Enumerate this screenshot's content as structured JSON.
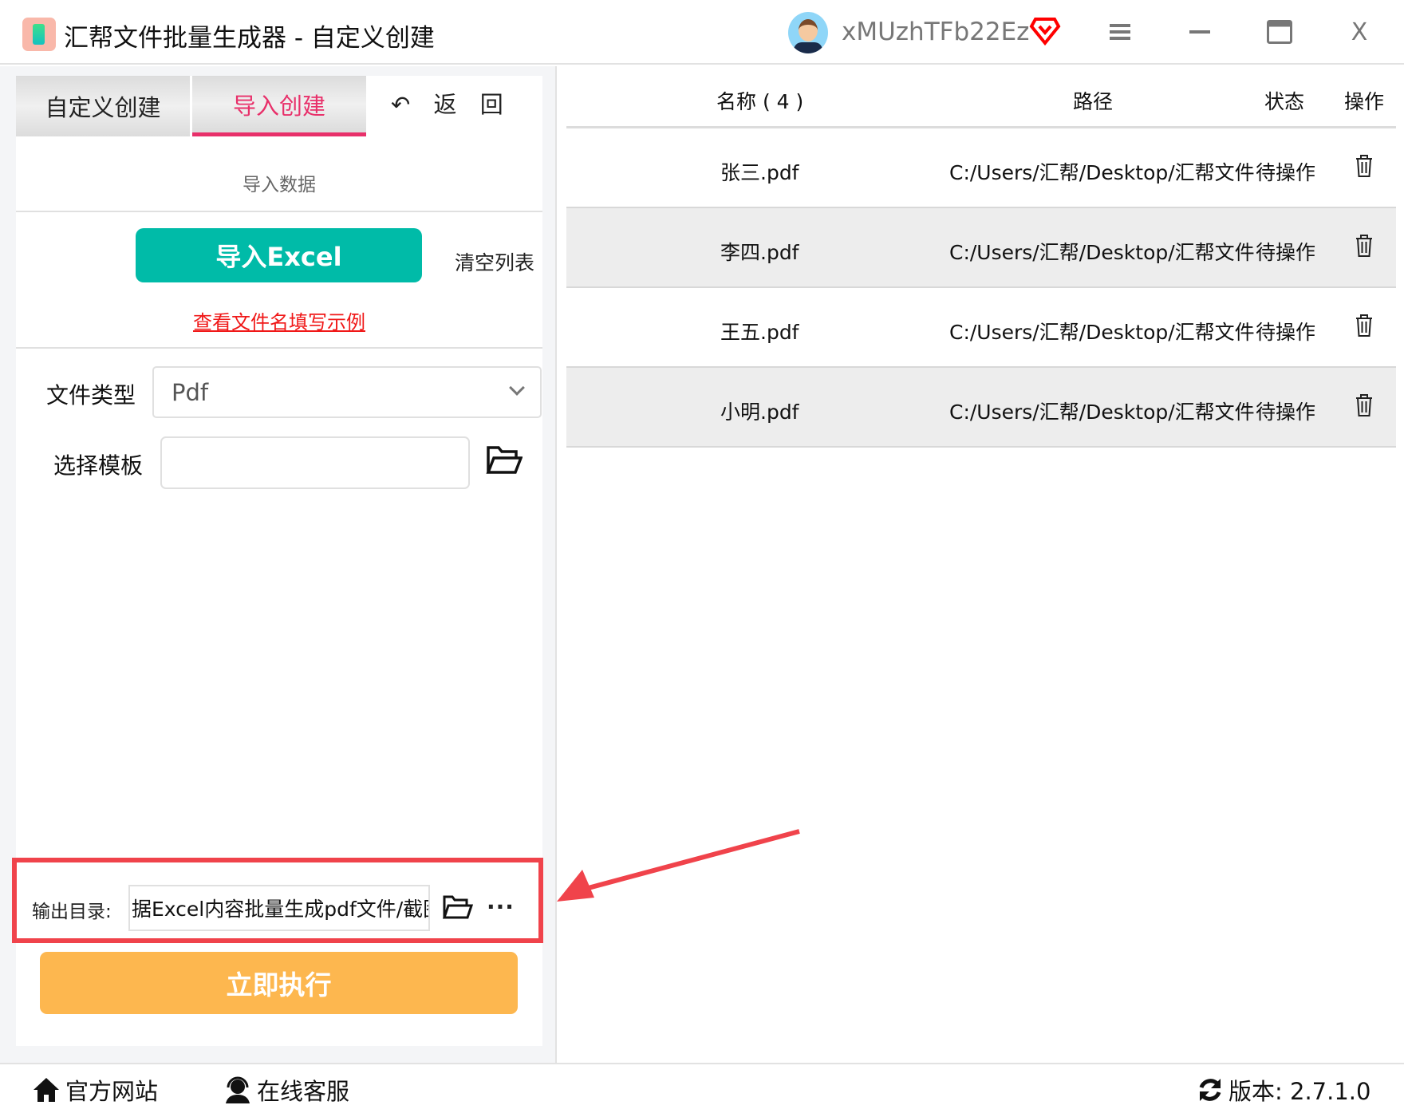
{
  "titlebar": {
    "title": "汇帮文件批量生成器 - 自定义创建",
    "username": "xMUzhTFb22Ez",
    "menu_icon": "hamburger-icon",
    "minimize_icon": "minimize-icon",
    "maximize_icon": "maximize-icon",
    "close_label": "X"
  },
  "left": {
    "tabs": [
      {
        "label": "自定义创建",
        "active": false
      },
      {
        "label": "导入创建",
        "active": true
      }
    ],
    "back_label": "返 回",
    "section_title": "导入数据",
    "import_button": "导入Excel",
    "clear_list": "清空列表",
    "example_link": "查看文件名填写示例",
    "file_type_label": "文件类型",
    "file_type_value": "Pdf",
    "template_label": "选择模板",
    "template_value": "",
    "output_label": "输出目录:",
    "output_value": "据Excel内容批量生成pdf文件/截图",
    "more_label": "···",
    "execute_button": "立即执行"
  },
  "table": {
    "headers": {
      "name": "名称 ( 4 )",
      "path": "路径",
      "status": "状态",
      "action": "操作"
    },
    "rows": [
      {
        "name": "张三.pdf",
        "path": "C:/Users/汇帮/Desktop/汇帮文件",
        "status": "待操作"
      },
      {
        "name": "李四.pdf",
        "path": "C:/Users/汇帮/Desktop/汇帮文件",
        "status": "待操作"
      },
      {
        "name": "王五.pdf",
        "path": "C:/Users/汇帮/Desktop/汇帮文件",
        "status": "待操作"
      },
      {
        "name": "小明.pdf",
        "path": "C:/Users/汇帮/Desktop/汇帮文件",
        "status": "待操作"
      }
    ]
  },
  "footer": {
    "website": "官方网站",
    "support": "在线客服",
    "version": "版本:  2.7.1.0"
  },
  "colors": {
    "accent": "#e8306a",
    "import_button": "#00bba8",
    "execute_button": "#fdb74f",
    "highlight": "#f0434b",
    "link": "#f01818"
  }
}
